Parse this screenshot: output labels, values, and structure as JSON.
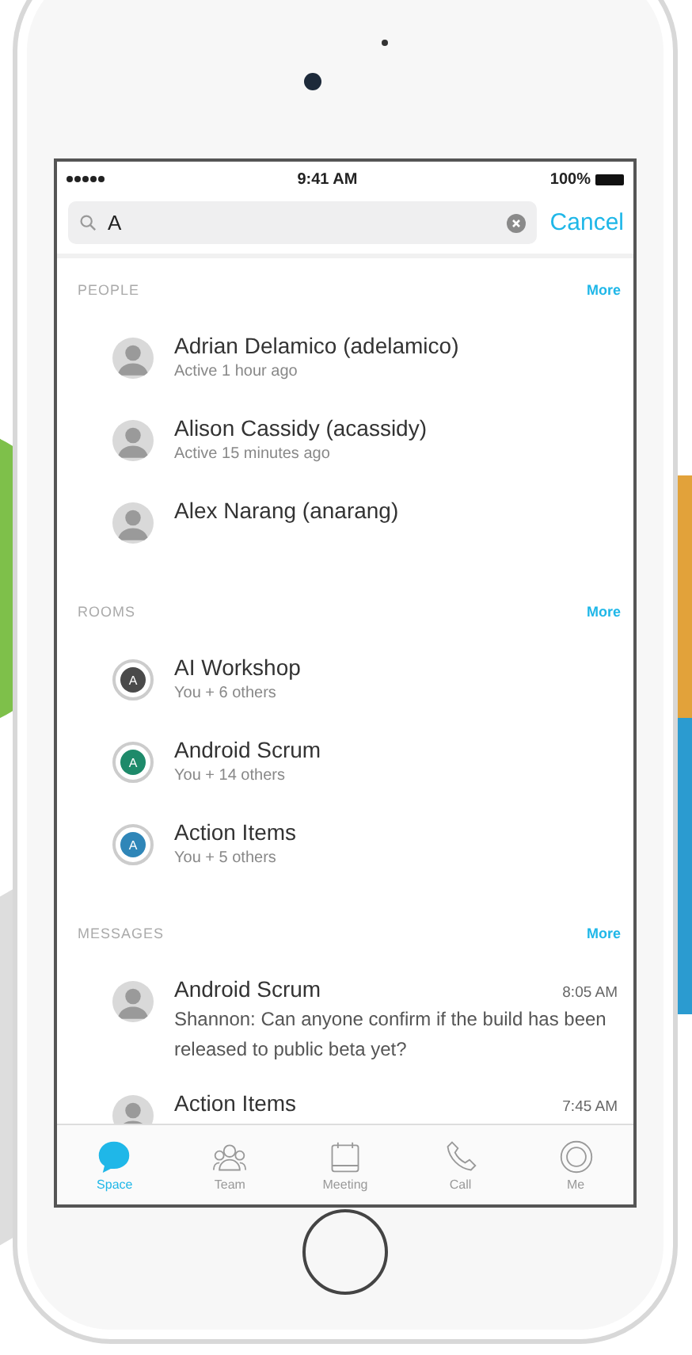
{
  "status_bar": {
    "time": "9:41 AM",
    "battery": "100%"
  },
  "search": {
    "value": "A",
    "cancel": "Cancel"
  },
  "sections": [
    {
      "title": "PEOPLE",
      "more": "More",
      "kind": "people",
      "items": [
        {
          "name": "Adrian Delamico (adelamico)",
          "subtitle": "Active 1 hour ago"
        },
        {
          "name": "Alison Cassidy (acassidy)",
          "subtitle": "Active 15 minutes ago"
        },
        {
          "name": "Alex Narang (anarang)"
        }
      ]
    },
    {
      "title": "ROOMS",
      "more": "More",
      "kind": "rooms",
      "items": [
        {
          "name": "AI Workshop",
          "subtitle": "You + 6 others",
          "letter": "A",
          "color": "#4a4a4a"
        },
        {
          "name": "Android Scrum",
          "subtitle": "You + 14 others",
          "letter": "A",
          "color": "#1e8a6a"
        },
        {
          "name": "Action Items",
          "subtitle": "You + 5 others",
          "letter": "A",
          "color": "#2f86b8"
        }
      ]
    },
    {
      "title": "MESSAGES",
      "more": "More",
      "kind": "messages",
      "items": [
        {
          "name": "Android Scrum",
          "time": "8:05 AM",
          "subtitle": "Shannon: Can anyone confirm if the build has been released to public beta yet?"
        },
        {
          "name": "Action Items",
          "time": "7:45 AM"
        }
      ]
    }
  ],
  "tabs": [
    {
      "label": "Space",
      "selected": true
    },
    {
      "label": "Team",
      "selected": false
    },
    {
      "label": "Meeting",
      "selected": false
    },
    {
      "label": "Call",
      "selected": false
    },
    {
      "label": "Me",
      "selected": false
    }
  ]
}
